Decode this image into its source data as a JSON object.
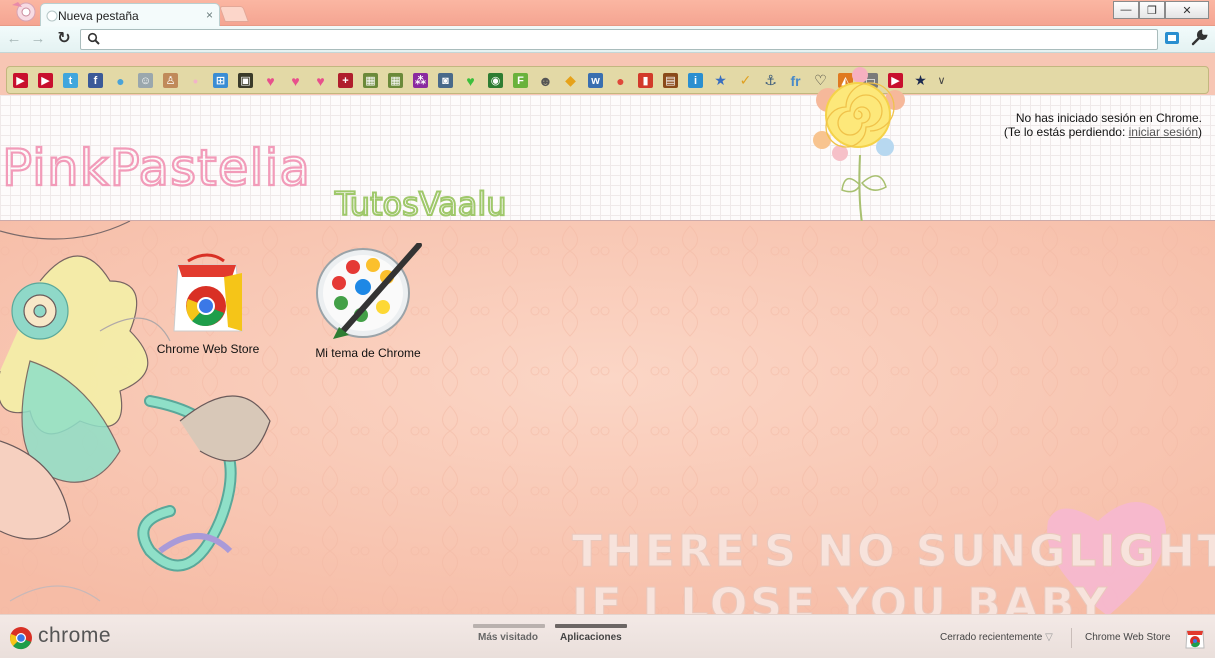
{
  "window": {
    "tab_title": "Nueva pestaña",
    "tab_close": "×",
    "minimize": "—",
    "maximize": "❐",
    "close": "✕"
  },
  "toolbar": {
    "back": "←",
    "forward": "→",
    "reload": "↻",
    "omnibox_value": "",
    "omnibox_placeholder": "",
    "star": "☆"
  },
  "bookmarks": [
    {
      "icon": "youtube-icon",
      "glyph": "▶",
      "color": "#c8102e"
    },
    {
      "icon": "youtube-icon",
      "glyph": "▶",
      "color": "#c8102e"
    },
    {
      "icon": "twitter-icon",
      "glyph": "t",
      "color": "#3fa6dd"
    },
    {
      "icon": "facebook-icon",
      "glyph": "f",
      "color": "#3b5a98"
    },
    {
      "icon": "bird-icon",
      "glyph": "●",
      "color": "#4aa3d8"
    },
    {
      "icon": "ghost-icon",
      "glyph": "☺",
      "color": "#9aa7ad"
    },
    {
      "icon": "person-icon",
      "glyph": "♙",
      "color": "#c08a5a"
    },
    {
      "icon": "pink-dot-icon",
      "glyph": "•",
      "color": "#f2b3c9"
    },
    {
      "icon": "windows-icon",
      "glyph": "⊞",
      "color": "#3a8dd4"
    },
    {
      "icon": "picture-icon",
      "glyph": "▣",
      "color": "#3b3b2a"
    },
    {
      "icon": "heart-icon",
      "glyph": "♥",
      "color": "#e8508c"
    },
    {
      "icon": "heart-icon",
      "glyph": "♥",
      "color": "#e8508c"
    },
    {
      "icon": "heart-icon",
      "glyph": "♥",
      "color": "#e8508c"
    },
    {
      "icon": "plus-icon",
      "glyph": "+",
      "color": "#b01e2c"
    },
    {
      "icon": "image-icon",
      "glyph": "▦",
      "color": "#6b8a3a"
    },
    {
      "icon": "image-icon",
      "glyph": "▦",
      "color": "#6b8a3a"
    },
    {
      "icon": "dots-icon",
      "glyph": "⁂",
      "color": "#8a2aa0"
    },
    {
      "icon": "photo-icon",
      "glyph": "◙",
      "color": "#4a6a8a"
    },
    {
      "icon": "green-heart-icon",
      "glyph": "♥",
      "color": "#3cbf3c"
    },
    {
      "icon": "globe-icon",
      "glyph": "◉",
      "color": "#2e7d32"
    },
    {
      "icon": "feed-icon",
      "glyph": "F",
      "color": "#6ab23c"
    },
    {
      "icon": "face-icon",
      "glyph": "☻",
      "color": "#555"
    },
    {
      "icon": "candy-icon",
      "glyph": "◆",
      "color": "#e6a21a"
    },
    {
      "icon": "w-icon",
      "glyph": "w",
      "color": "#3a6fb0"
    },
    {
      "icon": "dots-color-icon",
      "glyph": "●",
      "color": "#e0483a"
    },
    {
      "icon": "flag-icon",
      "glyph": "▮",
      "color": "#d23a2a"
    },
    {
      "icon": "box-icon",
      "glyph": "▤",
      "color": "#8a4a1a"
    },
    {
      "icon": "i-icon",
      "glyph": "i",
      "color": "#2a8fd0"
    },
    {
      "icon": "star-box-icon",
      "glyph": "★",
      "color": "#3a6fc0"
    },
    {
      "icon": "check-icon",
      "glyph": "✓",
      "color": "#e0a020"
    },
    {
      "icon": "anchor-icon",
      "glyph": "⚓",
      "color": "#3a5a7a"
    },
    {
      "icon": "fr-icon",
      "glyph": "fr",
      "color": "#4a8ac8"
    },
    {
      "icon": "heart-outline-icon",
      "glyph": "♡",
      "color": "#333"
    },
    {
      "icon": "fox-icon",
      "glyph": "◭",
      "color": "#e07a20"
    },
    {
      "icon": "chat-icon",
      "glyph": "▭",
      "color": "#7a7a7a"
    },
    {
      "icon": "youtube-icon",
      "glyph": "▶",
      "color": "#c8102e"
    },
    {
      "icon": "star-icon",
      "glyph": "★",
      "color": "#1c2a50"
    }
  ],
  "bookmarks_more": "∨",
  "header": {
    "logo_text": "PinkPastelia",
    "logo_sub": "TutosVaalu",
    "signin_line1": "No has iniciado sesión en Chrome.",
    "signin_line2_pre": "(Te lo estás perdiendo: ",
    "signin_link": "iniciar sesión",
    "signin_line2_post": ")"
  },
  "apps": [
    {
      "label": "Chrome Web Store",
      "icon": "chrome-web-store-icon"
    },
    {
      "label": "Mi tema de Chrome",
      "icon": "palette-icon"
    }
  ],
  "wallpaper_text": {
    "line1": "THERE'S NO SUNGLIGHT",
    "line2": "IF I LOSE YOU BABY"
  },
  "bottom": {
    "brand": "chrome",
    "sections": [
      "Más visitado",
      "Aplicaciones"
    ],
    "active_section": "Aplicaciones",
    "recent": "Cerrado recientemente",
    "recent_arrow": "▽",
    "store": "Chrome Web Store"
  },
  "colors": {
    "titlebar": "#f5a592",
    "bookmark_bar": "#e3d9a6",
    "main_bg": "#f8c9b6",
    "logo_pink": "#f29bb9",
    "logo_green": "#9fc86a"
  }
}
